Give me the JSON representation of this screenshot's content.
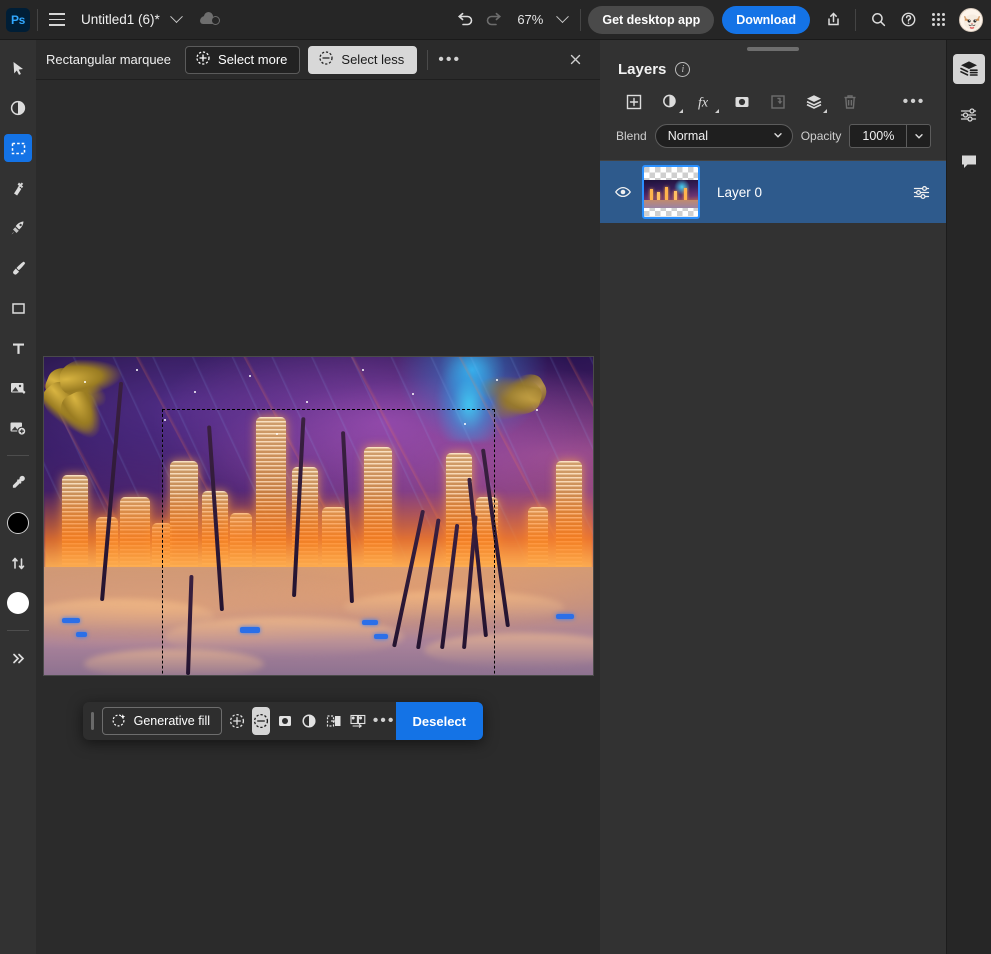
{
  "app": {
    "logo_text": "Ps",
    "document_title": "Untitled1 (6)*",
    "zoom_level": "67%"
  },
  "topbar": {
    "get_desktop_app_label": "Get desktop app",
    "download_label": "Download",
    "icons": {
      "menu": "hamburger-icon",
      "title_chevron": "chevron-down-icon",
      "cloud": "cloud-sync-icon",
      "undo": "undo-icon",
      "redo": "redo-icon",
      "zoom_chevron": "chevron-down-icon",
      "share": "share-icon",
      "search": "search-icon",
      "help": "help-icon",
      "apps": "apps-grid-icon",
      "avatar": "user-avatar"
    }
  },
  "left_toolbar": {
    "tools": [
      {
        "name": "move-tool",
        "icon": "cursor-arrow-icon",
        "active": false
      },
      {
        "name": "adjustment-tool",
        "icon": "half-circle-icon",
        "active": false
      },
      {
        "name": "rectangular-marquee-tool",
        "icon": "marquee-icon",
        "active": true
      },
      {
        "name": "spot-healing-tool",
        "icon": "healing-brush-icon",
        "active": false
      },
      {
        "name": "remove-tool",
        "icon": "rocket-icon",
        "active": false
      },
      {
        "name": "brush-tool",
        "icon": "brush-icon",
        "active": false
      },
      {
        "name": "shape-tool",
        "icon": "rectangle-icon",
        "active": false
      },
      {
        "name": "type-tool",
        "icon": "type-t-icon",
        "active": false
      },
      {
        "name": "image-tool",
        "icon": "image-icon",
        "active": false
      },
      {
        "name": "place-image-tool",
        "icon": "add-image-icon",
        "active": false
      },
      {
        "name": "eyedropper-tool",
        "icon": "eyedropper-icon",
        "active": false
      }
    ],
    "foreground_color": "#000000",
    "background_color": "#ffffff",
    "swap_icon": "swap-arrows-icon",
    "expand_icon": "double-chevron-right-icon"
  },
  "context_toolbar": {
    "tool_label": "Rectangular marquee",
    "select_more_label": "Select more",
    "select_less_label": "Select less",
    "select_less_active": true,
    "more_options": "•••",
    "close_icon": "close-icon"
  },
  "canvas": {
    "artwork_description": "Neon cityscape with palm trees over sand dunes",
    "selection_active": true
  },
  "floating_toolbar": {
    "generative_fill_label": "Generative fill",
    "deselect_label": "Deselect",
    "more_options": "•••",
    "buttons": [
      {
        "name": "add-to-selection-button",
        "icon": "plus-circle-dashed-icon",
        "active": false
      },
      {
        "name": "subtract-from-selection-button",
        "icon": "minus-circle-dashed-icon",
        "active": true
      },
      {
        "name": "create-mask-button",
        "icon": "mask-icon",
        "active": false
      },
      {
        "name": "adjustment-button",
        "icon": "half-circle-icon",
        "active": false
      },
      {
        "name": "selection-to-layer-button",
        "icon": "selection-to-layer-icon",
        "active": false
      },
      {
        "name": "duplicate-panels-button",
        "icon": "two-panels-icon",
        "active": false
      }
    ]
  },
  "layers_panel": {
    "title": "Layers",
    "info_icon": "info-icon",
    "blend_label": "Blend",
    "blend_value": "Normal",
    "opacity_label": "Opacity",
    "opacity_value": "100%",
    "toolbar_icons": [
      {
        "name": "add-layer-button",
        "icon": "plus-box-icon",
        "dim": false
      },
      {
        "name": "adjustment-layer-button",
        "icon": "half-circle-icon",
        "dim": false
      },
      {
        "name": "layer-effects-button",
        "icon": "fx-icon",
        "dim": false
      },
      {
        "name": "layer-mask-button",
        "icon": "mask-icon",
        "dim": false
      },
      {
        "name": "clipping-mask-button",
        "icon": "clipping-mask-icon",
        "dim": true
      },
      {
        "name": "group-layers-button",
        "icon": "layers-stack-icon",
        "dim": false
      },
      {
        "name": "delete-layer-button",
        "icon": "trash-icon",
        "dim": true
      },
      {
        "name": "layer-more-options-button",
        "icon": "more-dots-icon",
        "dim": false
      }
    ],
    "layers": [
      {
        "name": "Layer 0",
        "visible": true,
        "selected": true,
        "visibility_icon": "eye-icon",
        "properties_icon": "sliders-icon"
      }
    ]
  },
  "right_rail": {
    "items": [
      {
        "name": "rail-layers-panel-button",
        "icon": "layers-stack-icon",
        "active": true
      },
      {
        "name": "rail-properties-panel-button",
        "icon": "sliders-icon",
        "active": false
      },
      {
        "name": "rail-comments-panel-button",
        "icon": "comment-bubble-icon",
        "active": false
      }
    ]
  }
}
